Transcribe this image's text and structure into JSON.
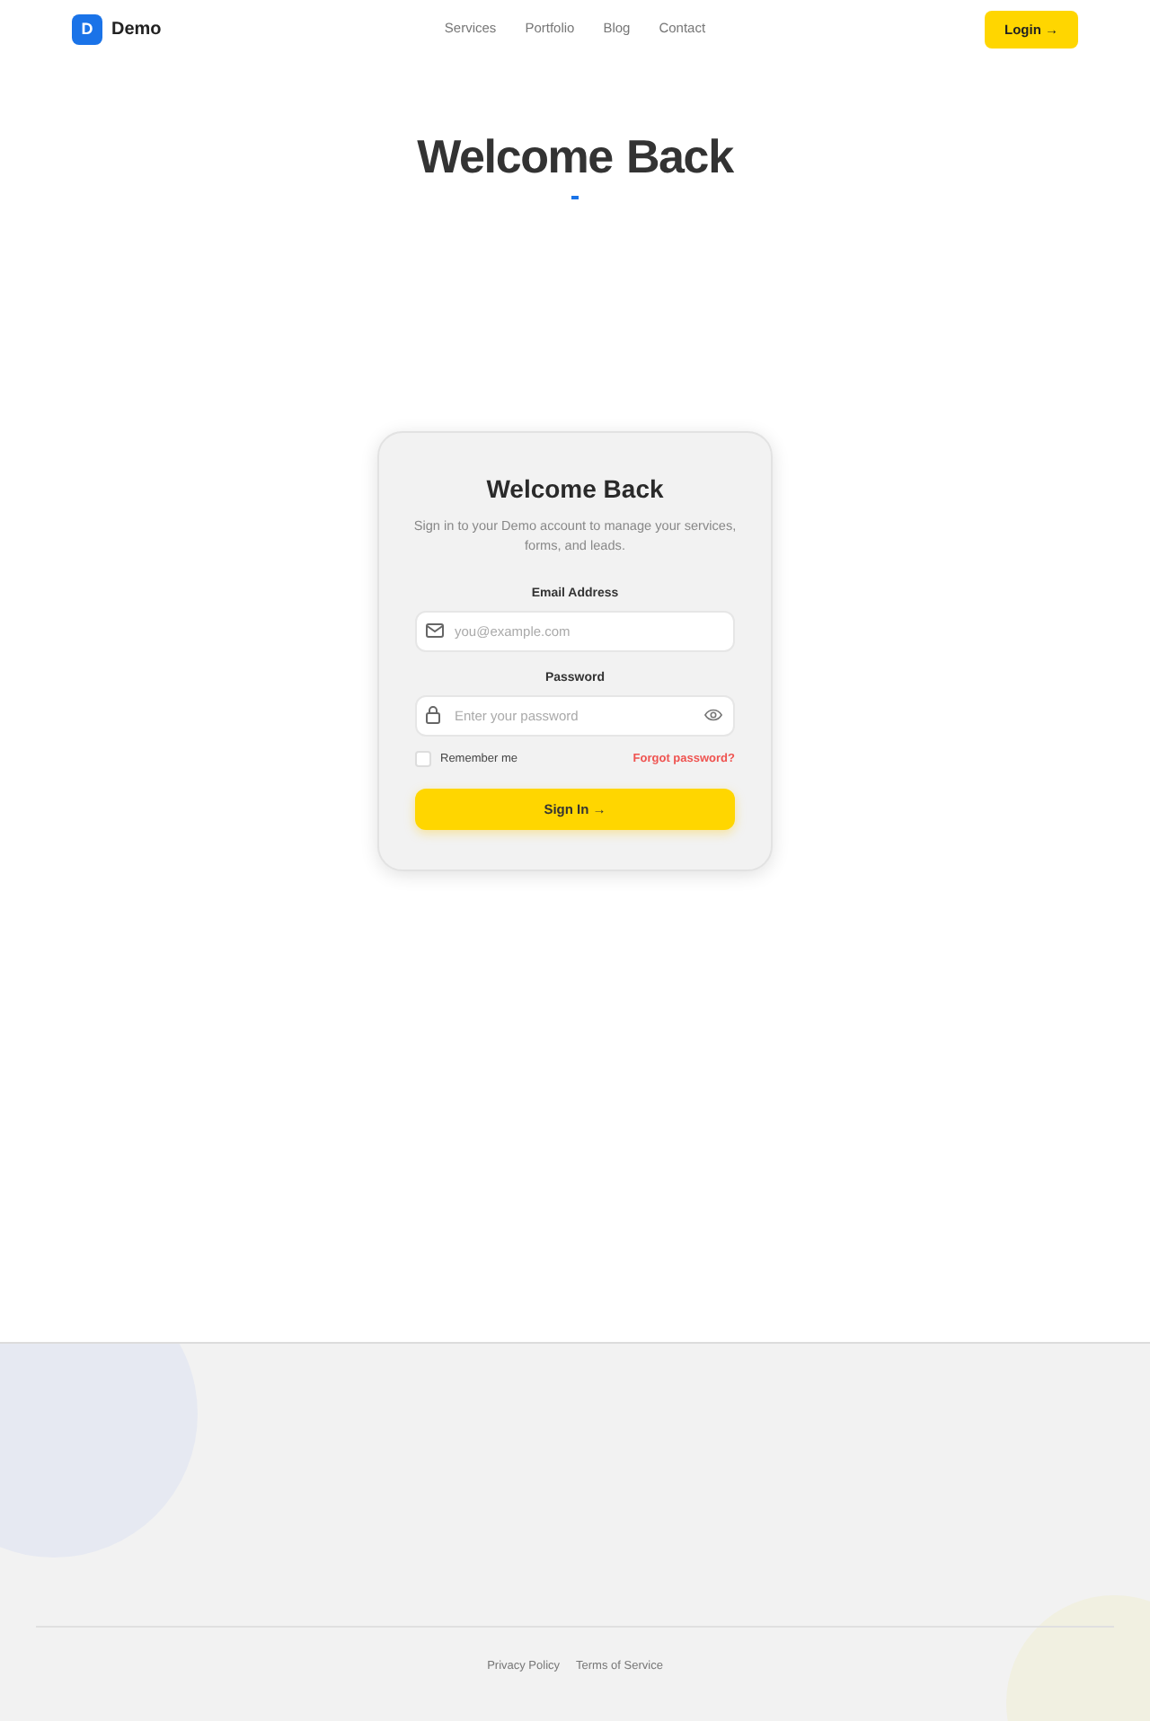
{
  "header": {
    "logo": {
      "letter": "D",
      "name": "Demo"
    },
    "nav": [
      {
        "label": "Services"
      },
      {
        "label": "Portfolio"
      },
      {
        "label": "Blog"
      },
      {
        "label": "Contact"
      }
    ],
    "login_button": "Login →"
  },
  "hero": {
    "title": "Welcome Back"
  },
  "login_card": {
    "title": "Welcome Back",
    "subtitle": "Sign in to your Demo account to manage your services, forms, and leads.",
    "fields": [
      {
        "kind": "email",
        "label": "Email Address",
        "placeholder": "you@example.com"
      },
      {
        "kind": "password",
        "label": "Password",
        "placeholder": "Enter your password"
      }
    ],
    "remember": {
      "label": "Remember me",
      "checked": false
    },
    "forgot_link": "Forgot password?",
    "submit": "Sign In →"
  },
  "footer": {
    "links": [
      "Privacy Policy",
      "Terms of Service"
    ]
  }
}
